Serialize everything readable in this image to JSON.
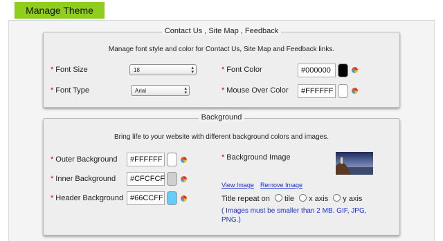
{
  "header": {
    "tab_label": "Manage Theme"
  },
  "contact_section": {
    "title": "Contact Us , Site Map , Feedback",
    "description": "Manage font style and color for Contact Us, Site Map and Feedback links.",
    "required_mark": "*",
    "font_size": {
      "label": "Font Size",
      "value": "18"
    },
    "font_type": {
      "label": "Font Type",
      "value": "Arial"
    },
    "font_color": {
      "label": "Font Color",
      "value": "#000000",
      "color": "#000000"
    },
    "mouse_over_color": {
      "label": "Mouse Over Color",
      "value": "#FFFFFF",
      "color": "#FFFFFF"
    }
  },
  "background_section": {
    "title": "Background",
    "description": "Bring life to your website with different background colors and images.",
    "required_mark": "*",
    "outer_background": {
      "label": "Outer Background",
      "value": "#FFFFFF",
      "color": "#FFFFFF"
    },
    "inner_background": {
      "label": "Inner Background",
      "value": "#CFCFCF",
      "color": "#CFCFCF"
    },
    "header_background": {
      "label": "Header Background",
      "value": "#66CCFF",
      "color": "#66CCFF"
    },
    "background_image": {
      "label": "Background Image",
      "view_link": "View Image",
      "remove_link": "Remove Image"
    },
    "title_repeat": {
      "label": "Title repeat on",
      "options": [
        "tile",
        "x axis",
        "y axis"
      ]
    },
    "note": "( Images must be smaller than 2 MB. GIF, JPG, PNG.)"
  },
  "icons": {
    "color_picker": "color-wheel-icon",
    "select_arrow": "up-down-arrow-icon"
  }
}
